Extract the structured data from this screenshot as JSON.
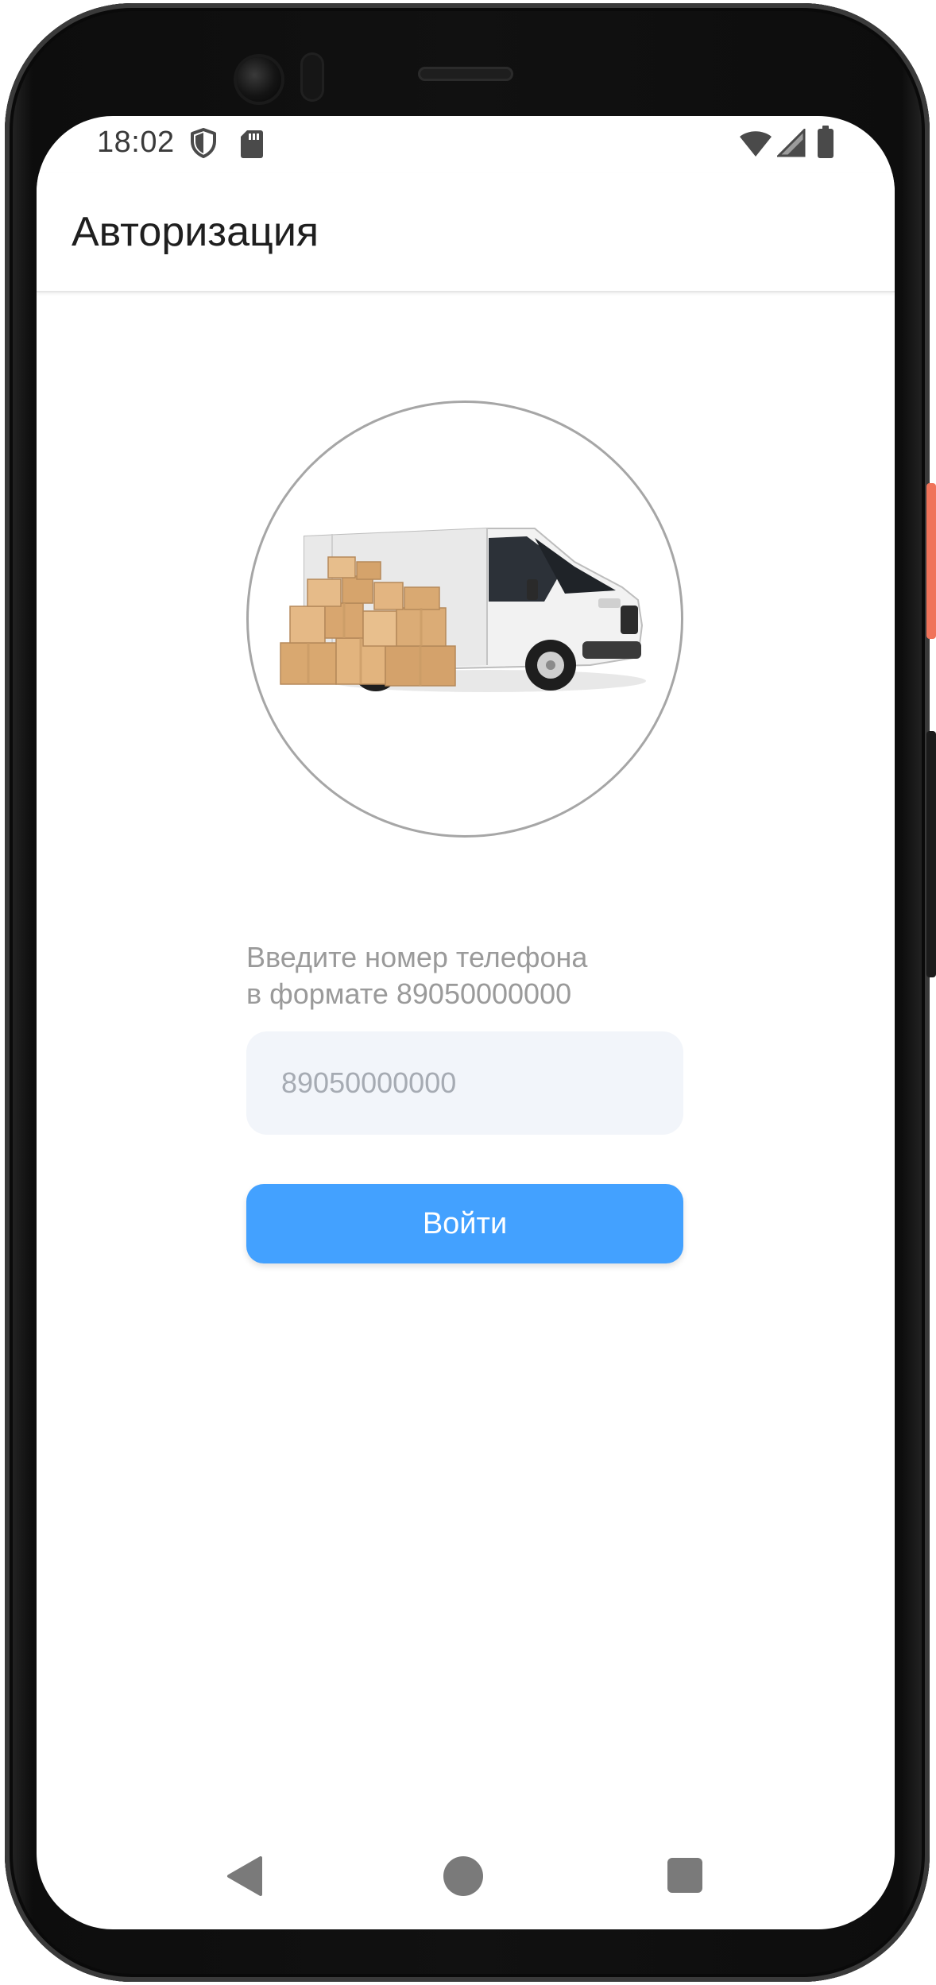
{
  "status_bar": {
    "time": "18:02",
    "icons": [
      "shield-icon",
      "sd-card-icon",
      "wifi-icon",
      "signal-icon",
      "battery-icon"
    ]
  },
  "app_bar": {
    "title": "Авторизация"
  },
  "illustration": {
    "icon": "delivery-van-with-boxes-icon"
  },
  "login": {
    "prompt_line1": "Введите номер телефона",
    "prompt_line2": "в формате 89050000000",
    "phone_placeholder": "89050000000",
    "phone_value": "",
    "submit_label": "Войти"
  },
  "navigation": {
    "icons": [
      "back-icon",
      "home-icon",
      "recents-icon"
    ]
  },
  "colors": {
    "accent": "#43a1ff",
    "input_background": "#f2f5fa",
    "prompt_text": "#9a9a9a",
    "side_button": "#f0735a"
  }
}
